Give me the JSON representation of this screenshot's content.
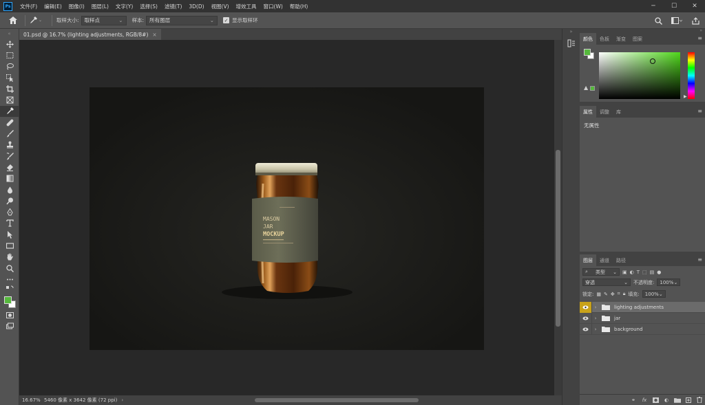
{
  "app": {
    "logo": "Ps"
  },
  "menu": [
    "文件(F)",
    "编辑(E)",
    "图像(I)",
    "图层(L)",
    "文字(Y)",
    "选择(S)",
    "滤镜(T)",
    "3D(D)",
    "视图(V)",
    "增效工具",
    "窗口(W)",
    "帮助(H)"
  ],
  "window_controls": {
    "minimize": "─",
    "maximize": "☐",
    "close": "✕"
  },
  "options": {
    "sample_size_label": "取样大小:",
    "sample_size_value": "取样点",
    "sample_label": "样本:",
    "sample_value": "所有图层",
    "show_ring_label": "显示取样环"
  },
  "document_tab": {
    "title": "01.psd @ 16.7% (lighting adjustments, RGB/8#)",
    "close": "×"
  },
  "status": {
    "zoom": "16.67%",
    "doc_info": "5460 像素 x 3642 像素 (72 ppi)",
    "arrow": "›"
  },
  "colors": {
    "foreground": "#55b83c",
    "background": "#ffffff",
    "selected_layer_eye": "#c8a21a"
  },
  "color_panel": {
    "tabs": [
      "颜色",
      "色板",
      "渐变",
      "图案"
    ]
  },
  "properties_panel": {
    "tabs": [
      "属性",
      "调整",
      "库"
    ],
    "empty_text": "无属性"
  },
  "layers_panel": {
    "tabs": [
      "图层",
      "通道",
      "路径"
    ],
    "filter_kind": "类型",
    "blend_mode": "穿透",
    "opacity_label": "不透明度:",
    "opacity_value": "100%",
    "lock_label": "锁定:",
    "fill_label": "填充:",
    "fill_value": "100%",
    "layers": [
      {
        "name": "lighting adjustments",
        "selected": true
      },
      {
        "name": "jar",
        "selected": false
      },
      {
        "name": "background",
        "selected": false
      }
    ],
    "footer_icons": [
      "link-icon",
      "fx-icon",
      "mask-icon",
      "adjustment-icon",
      "group-icon",
      "new-layer-icon",
      "trash-icon"
    ],
    "footer_fx": "fx"
  },
  "jar_label": {
    "line1": "MASON",
    "line2": "JAR",
    "line3": "MOCKUP"
  }
}
